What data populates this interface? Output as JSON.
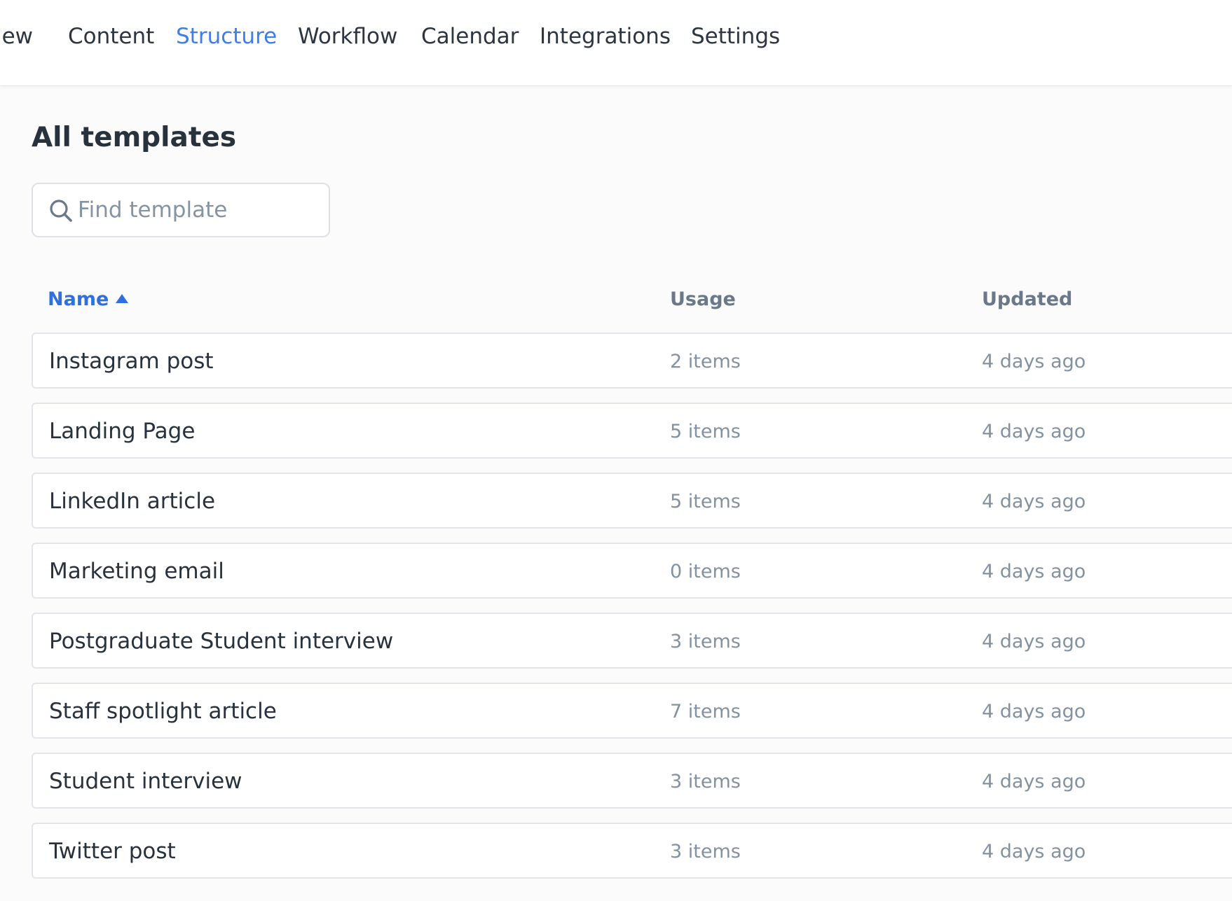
{
  "nav": {
    "items": [
      {
        "label": "iew",
        "active": false
      },
      {
        "label": "Content",
        "active": false
      },
      {
        "label": "Structure",
        "active": true
      },
      {
        "label": "Workflow",
        "active": false
      },
      {
        "label": "Calendar",
        "active": false
      },
      {
        "label": "Integrations",
        "active": false
      },
      {
        "label": "Settings",
        "active": false
      }
    ]
  },
  "page": {
    "title": "All templates"
  },
  "search": {
    "placeholder": "Find template",
    "value": "",
    "icon": "search-icon"
  },
  "table": {
    "columns": {
      "name": "Name",
      "usage": "Usage",
      "updated": "Updated"
    },
    "sort": {
      "column": "name",
      "direction": "ascending"
    },
    "rows": [
      {
        "name": "Instagram post",
        "usage": "2 items",
        "updated": "4 days ago"
      },
      {
        "name": "Landing Page",
        "usage": "5 items",
        "updated": "4 days ago"
      },
      {
        "name": "LinkedIn article",
        "usage": "5 items",
        "updated": "4 days ago"
      },
      {
        "name": "Marketing email",
        "usage": "0 items",
        "updated": "4 days ago"
      },
      {
        "name": "Postgraduate Student interview",
        "usage": "3 items",
        "updated": "4 days ago"
      },
      {
        "name": "Staff spotlight article",
        "usage": "7 items",
        "updated": "4 days ago"
      },
      {
        "name": "Student interview",
        "usage": "3 items",
        "updated": "4 days ago"
      },
      {
        "name": "Twitter post",
        "usage": "3 items",
        "updated": "4 days ago"
      }
    ]
  },
  "colors": {
    "accent": "#3f7ee8",
    "text": "#28323d",
    "muted": "#8391a1",
    "border": "#e2e5e9",
    "background": "#fbfbfb"
  }
}
